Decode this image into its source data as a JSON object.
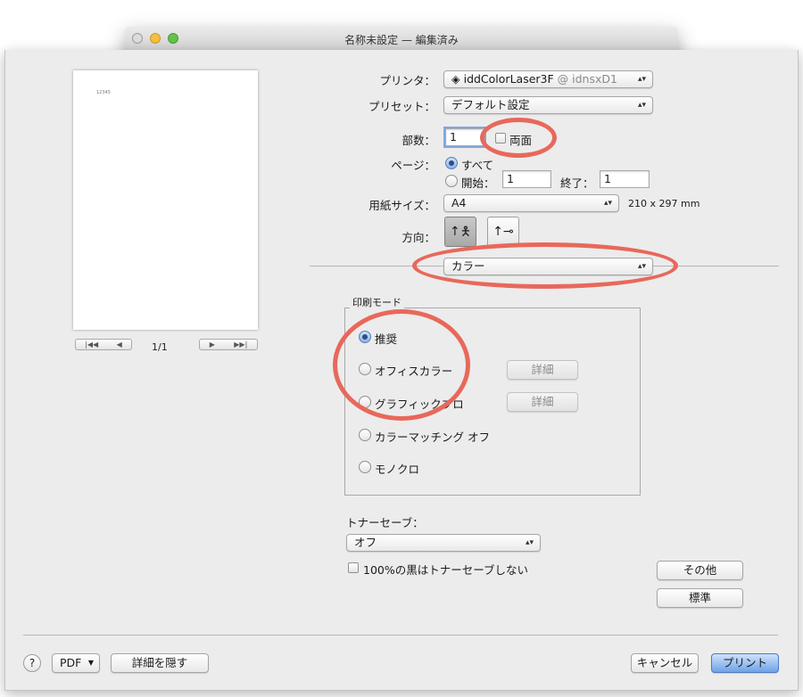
{
  "background_window": {
    "title": "名称未設定 — 編集済み"
  },
  "preview": {
    "page_text": "12345",
    "page_indicator": "1/1"
  },
  "form": {
    "printer_label": "プリンタ：",
    "printer_value": "iddColorLaser3F",
    "printer_host": "@ idnsxD1",
    "preset_label": "プリセット：",
    "preset_value": "デフォルト設定",
    "copies_label": "部数：",
    "copies_value": "1",
    "duplex_label": "両面",
    "duplex_checked": false,
    "pages_label": "ページ：",
    "pages_all_label": "すべて",
    "pages_from_label": "開始：",
    "pages_from_value": "1",
    "pages_to_label": "終了：",
    "pages_to_value": "1",
    "paper_label": "用紙サイズ：",
    "paper_value": "A4",
    "paper_dims": "210 x 297 mm",
    "orientation_label": "方向：",
    "section_value": "カラー"
  },
  "print_mode": {
    "title": "印刷モード",
    "options": [
      {
        "label": "推奨",
        "selected": true
      },
      {
        "label": "オフィスカラー",
        "selected": false,
        "detail": "詳細"
      },
      {
        "label": "グラフィックプロ",
        "selected": false,
        "detail": "詳細"
      },
      {
        "label": "カラーマッチング オフ",
        "selected": false
      },
      {
        "label": "モノクロ",
        "selected": false
      }
    ]
  },
  "toner_save": {
    "label": "トナーセーブ：",
    "value": "オフ",
    "black_checkbox_label": "100%の黒はトナーセーブしない"
  },
  "side_buttons": {
    "other": "その他",
    "standard": "標準"
  },
  "footer": {
    "help": "?",
    "pdf": "PDF",
    "hide_details": "詳細を隠す",
    "cancel": "キャンセル",
    "print": "プリント"
  },
  "colors": {
    "annotation_ring": "#e8685b",
    "primary_button": "#6fa2e8"
  },
  "icons": [
    "traffic-light-close",
    "traffic-light-minimize",
    "traffic-light-zoom",
    "printer-icon",
    "popup-arrows-icon",
    "portrait-icon",
    "landscape-icon"
  ]
}
